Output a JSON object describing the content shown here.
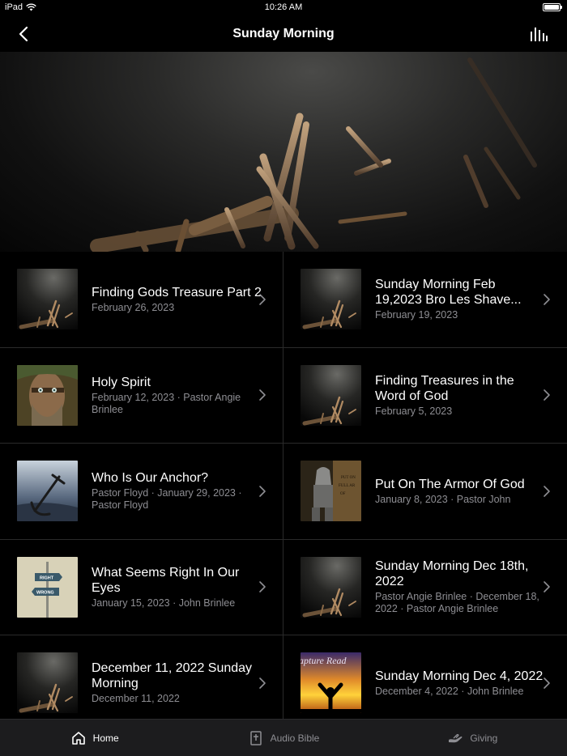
{
  "status": {
    "carrier": "iPad",
    "time": "10:26 AM"
  },
  "nav": {
    "title": "Sunday Morning"
  },
  "items": [
    {
      "title": "Finding Gods Treasure Part 2",
      "subtitle": "February 26, 2023",
      "thumb": "hands"
    },
    {
      "title": "Sunday Morning Feb 19,2023 Bro Les Shave...",
      "subtitle": "February 19, 2023",
      "thumb": "hands"
    },
    {
      "title": "Holy Spirit",
      "subtitle": "February 12, 2023 · Pastor Angie Brinlee",
      "thumb": "face"
    },
    {
      "title": "Finding Treasures in the Word of God",
      "subtitle": "February 5, 2023",
      "thumb": "hands"
    },
    {
      "title": "Who Is Our Anchor?",
      "subtitle": "Pastor Floyd · January 29, 2023 · Pastor Floyd",
      "thumb": "anchor"
    },
    {
      "title": "Put On The Armor Of God",
      "subtitle": "January 8, 2023 · Pastor John",
      "thumb": "armor"
    },
    {
      "title": "What Seems Right In Our Eyes",
      "subtitle": "January 15, 2023 · John Brinlee",
      "thumb": "sign"
    },
    {
      "title": "Sunday Morning Dec 18th, 2022",
      "subtitle": "Pastor Angie Brinlee · December 18, 2022 · Pastor Angie Brinlee",
      "thumb": "hands"
    },
    {
      "title": "December 11, 2022 Sunday Morning",
      "subtitle": "December 11, 2022",
      "thumb": "hands"
    },
    {
      "title": "Sunday Morning Dec 4, 2022",
      "subtitle": "December 4, 2022 · John Brinlee",
      "thumb": "rapture"
    }
  ],
  "thumb_text": {
    "sign_top": "RIGHT",
    "sign_bottom": "WRONG",
    "rapture": "apture Read",
    "armor": "PUT ON FULL ARMOR OF"
  },
  "tabs": [
    {
      "label": "Home",
      "icon": "home-icon",
      "active": true
    },
    {
      "label": "Audio Bible",
      "icon": "bible-icon",
      "active": false
    },
    {
      "label": "Giving",
      "icon": "giving-hands-icon",
      "active": false
    }
  ]
}
